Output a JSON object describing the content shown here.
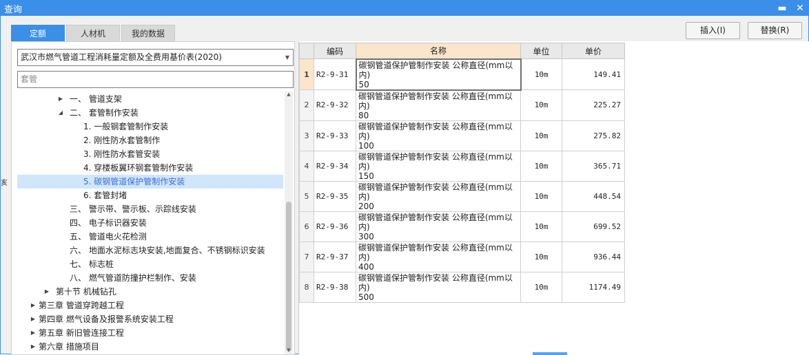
{
  "window": {
    "title": "查询",
    "minimize_glyph": "▬",
    "close_glyph": "✕"
  },
  "tabs": [
    {
      "label": "定额",
      "active": true
    },
    {
      "label": "人材机",
      "active": false
    },
    {
      "label": "我的数据",
      "active": false
    }
  ],
  "buttons": {
    "insert": "插入(I)",
    "replace": "替换(R)"
  },
  "library_select": {
    "value": "武汉市燃气管道工程消耗量定额及全费用基价表(2020)"
  },
  "search": {
    "value": "套管"
  },
  "tree": [
    {
      "label": "一、 管道支架",
      "toggle": "▶",
      "indent": 2
    },
    {
      "label": "二、 套管制作安装",
      "toggle": "◢",
      "indent": 2
    },
    {
      "label": "1. 一般钢套管制作安装",
      "toggle": "",
      "indent": 3
    },
    {
      "label": "2. 刚性防水套管制作",
      "toggle": "",
      "indent": 3
    },
    {
      "label": "3. 刚性防水套管安装",
      "toggle": "",
      "indent": 3
    },
    {
      "label": "4. 穿楼板翼环钢套管制作安装",
      "toggle": "",
      "indent": 3
    },
    {
      "label": "5. 碳钢管道保护管制作安装",
      "toggle": "",
      "indent": 3,
      "selected": true
    },
    {
      "label": "6. 套管封堵",
      "toggle": "",
      "indent": 3
    },
    {
      "label": "三、 警示带、警示板、示踪线安装",
      "toggle": "",
      "indent": 2
    },
    {
      "label": "四、 电子标识器安装",
      "toggle": "",
      "indent": 2
    },
    {
      "label": "五、 管道电火花检测",
      "toggle": "",
      "indent": 2
    },
    {
      "label": "六、 地面水泥标志块安装,地面复合、不锈钢标识安装",
      "toggle": "",
      "indent": 2
    },
    {
      "label": "七、 标志桩",
      "toggle": "",
      "indent": 2
    },
    {
      "label": "八、 燃气管道防撞护栏制作、安装",
      "toggle": "",
      "indent": 2
    },
    {
      "label": "第十节 机械钻孔",
      "toggle": "▶",
      "indent": 1
    },
    {
      "label": "第三章 管道穿跨越工程",
      "toggle": "▶",
      "indent": 0
    },
    {
      "label": "第四章 燃气设备及报警系统安装工程",
      "toggle": "▶",
      "indent": 0
    },
    {
      "label": "第五章 新旧管连接工程",
      "toggle": "▶",
      "indent": 0
    },
    {
      "label": "第六章 措施项目",
      "toggle": "▶",
      "indent": 0
    }
  ],
  "grid": {
    "headers": [
      "",
      "编码",
      "名称",
      "单位",
      "单价"
    ],
    "rows": [
      {
        "n": "1",
        "code": "R2-9-31",
        "name": "碳钢管道保护管制作安装 公称直径(mm以内)\n50",
        "unit": "10m",
        "price": "149.41",
        "selected": true
      },
      {
        "n": "2",
        "code": "R2-9-32",
        "name": "碳钢管道保护管制作安装 公称直径(mm以内)\n80",
        "unit": "10m",
        "price": "225.27"
      },
      {
        "n": "3",
        "code": "R2-9-33",
        "name": "碳钢管道保护管制作安装 公称直径(mm以内)\n100",
        "unit": "10m",
        "price": "275.82"
      },
      {
        "n": "4",
        "code": "R2-9-34",
        "name": "碳钢管道保护管制作安装 公称直径(mm以内)\n150",
        "unit": "10m",
        "price": "365.71"
      },
      {
        "n": "5",
        "code": "R2-9-35",
        "name": "碳钢管道保护管制作安装 公称直径(mm以内)\n200",
        "unit": "10m",
        "price": "448.54"
      },
      {
        "n": "6",
        "code": "R2-9-36",
        "name": "碳钢管道保护管制作安装 公称直径(mm以内)\n300",
        "unit": "10m",
        "price": "699.52"
      },
      {
        "n": "7",
        "code": "R2-9-37",
        "name": "碳钢管道保护管制作安装 公称直径(mm以内)\n400",
        "unit": "10m",
        "price": "936.44"
      },
      {
        "n": "8",
        "code": "R2-9-38",
        "name": "碳钢管道保护管制作安装 公称直径(mm以内)\n500",
        "unit": "10m",
        "price": "1174.49"
      }
    ]
  },
  "colors": {
    "accent": "#3c8fe8",
    "selected_row": "#cfe6fb",
    "header_highlight": "#fbe5cc"
  },
  "icons": {
    "tree_expand": "chevron-right-icon",
    "tree_collapse": "chevron-down-icon",
    "dropdown": "chevron-down-icon"
  }
}
